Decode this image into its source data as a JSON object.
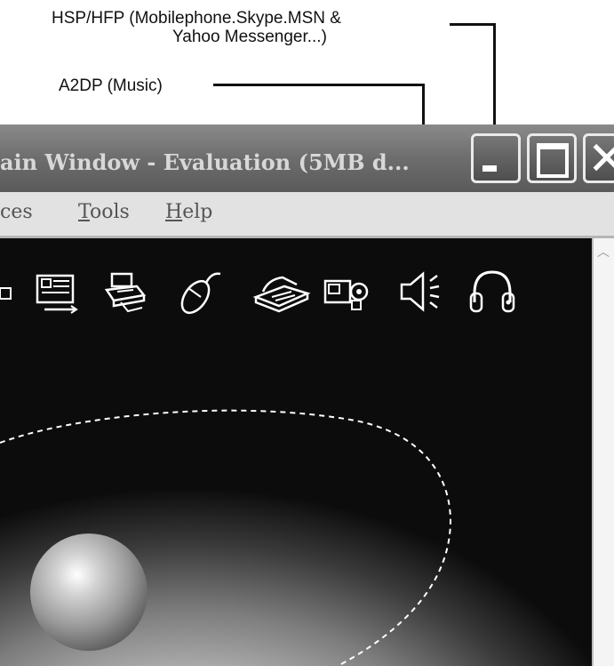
{
  "callouts": {
    "hsp_line1": "HSP/HFP (Mobilephone.Skype.MSN &",
    "hsp_line2": "Yahoo Messenger...)",
    "a2dp": "A2DP (Music)"
  },
  "window": {
    "title": "ain Window - Evaluation (5MB d...",
    "controls": [
      "minimize",
      "maximize",
      "close"
    ]
  },
  "menu": {
    "items": [
      {
        "label": "ces",
        "underline": ""
      },
      {
        "label": "ools",
        "underline": "T"
      },
      {
        "label": "elp",
        "underline": "H"
      }
    ]
  },
  "toolbar_icons": [
    "square-icon",
    "business-card-icon",
    "printer-icon",
    "mouse-icon",
    "fax-icon",
    "camcorder-icon",
    "speaker-icon",
    "headphones-icon"
  ]
}
